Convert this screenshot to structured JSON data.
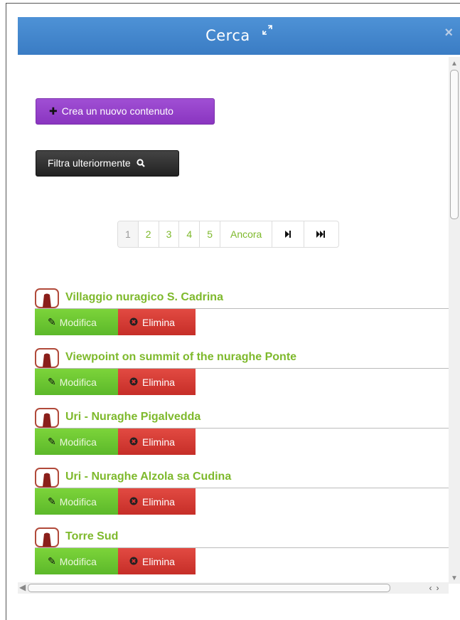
{
  "modal": {
    "title": "Cerca"
  },
  "toolbar": {
    "create_label": "Crea un nuovo contenuto",
    "filter_label": "Filtra ulteriormente"
  },
  "pagination": {
    "pages": [
      "1",
      "2",
      "3",
      "4",
      "5"
    ],
    "active_page": "1",
    "more_label": "Ancora"
  },
  "results": [
    {
      "title": "Villaggio nuragico S. Cadrina"
    },
    {
      "title": "Viewpoint on summit of the nuraghe Ponte"
    },
    {
      "title": "Uri - Nuraghe Pigalvedda"
    },
    {
      "title": "Uri - Nuraghe Alzola sa Cudina"
    },
    {
      "title": "Torre Sud"
    }
  ],
  "item_actions": {
    "edit_label": "Modifica",
    "delete_label": "Elimina"
  },
  "colors": {
    "header_blue": "#3a7cc4",
    "create_purple": "#8a35c0",
    "link_green": "#7eb92c",
    "edit_green": "#5cb82a",
    "delete_red": "#c62e28"
  },
  "icons": {
    "expand": "expand-arrows-icon",
    "close": "close-icon",
    "plus": "plus-icon",
    "search": "search-icon",
    "next": "next-page-icon",
    "last": "last-page-icon",
    "edit": "edit-icon",
    "delete": "delete-icon",
    "item": "nuraghe-icon"
  }
}
